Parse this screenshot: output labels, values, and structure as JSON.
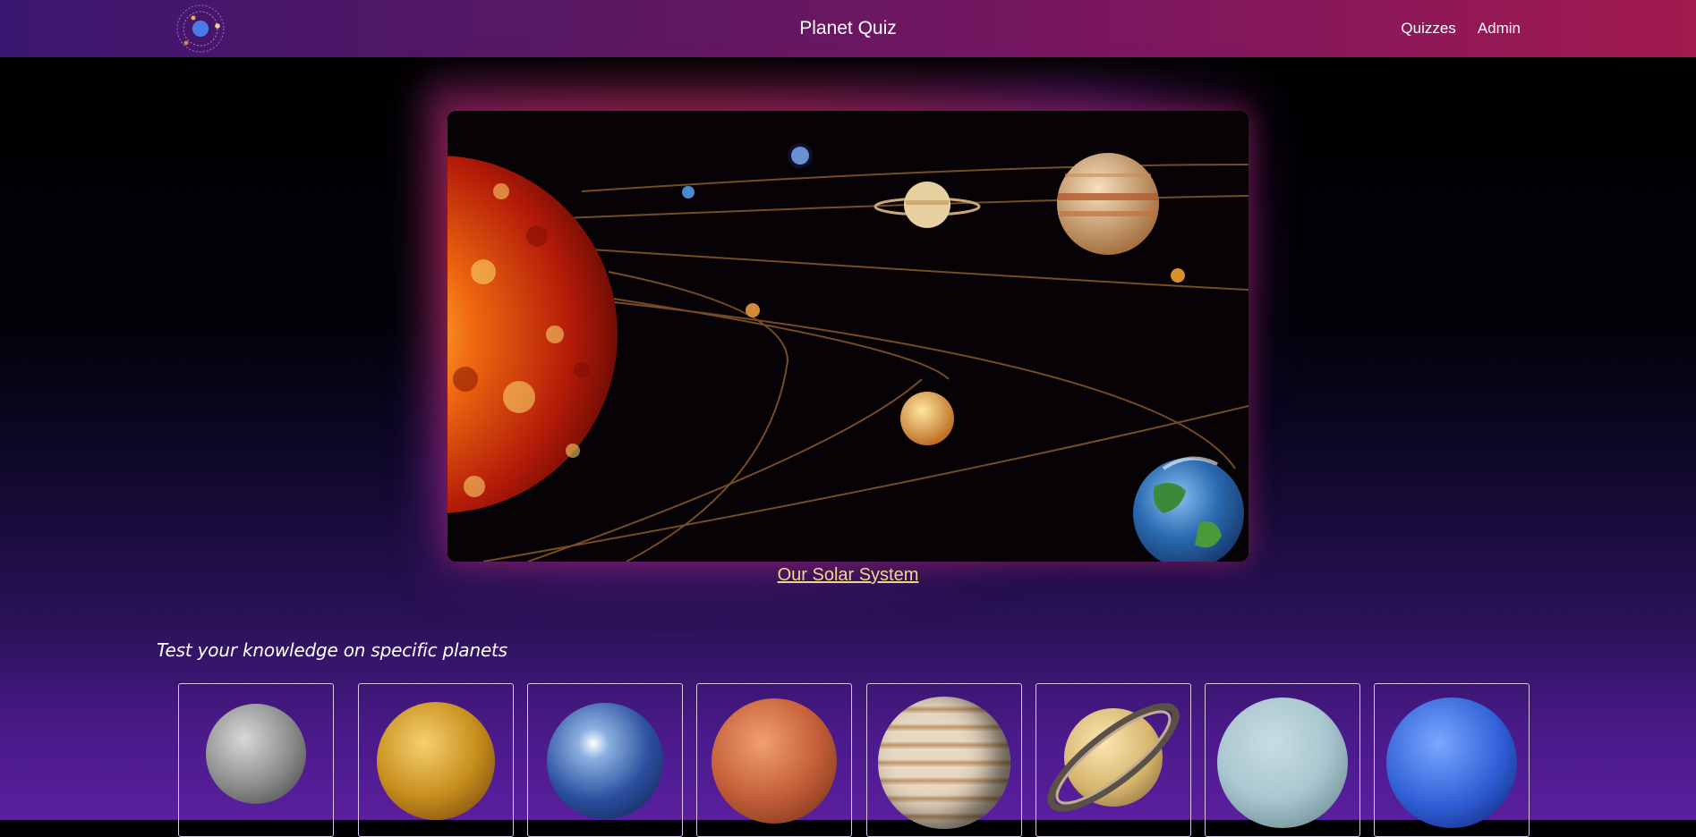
{
  "navbar": {
    "brand": "Planet Quiz",
    "logo_icon": "solar-system-logo-icon",
    "links": [
      "Quizzes",
      "Admin"
    ]
  },
  "hero": {
    "image_icon": "solar-system-illustration",
    "caption": "Our Solar System"
  },
  "section": {
    "heading": "Test your knowledge on specific planets"
  },
  "planets": [
    {
      "icon": "mercury-planet-icon",
      "color": "#8a8a8a"
    },
    {
      "icon": "venus-planet-icon",
      "color": "#c8901e"
    },
    {
      "icon": "earth-planet-icon",
      "color": "#2b4f9e"
    },
    {
      "icon": "mars-planet-icon",
      "color": "#c6603a"
    },
    {
      "icon": "jupiter-planet-icon",
      "color": "#c9b49a"
    },
    {
      "icon": "saturn-planet-icon",
      "color": "#d6b56e"
    },
    {
      "icon": "uranus-planet-icon",
      "color": "#a9c6cf"
    },
    {
      "icon": "neptune-planet-icon",
      "color": "#2f5fd6"
    }
  ],
  "colors": {
    "accent_link": "#f2d58a",
    "nav_start": "#3a1670",
    "nav_end": "#a21a4e"
  }
}
